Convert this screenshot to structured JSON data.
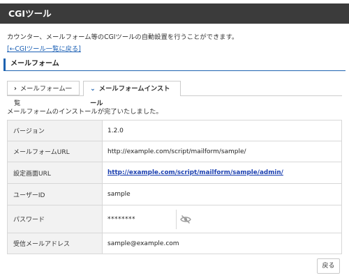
{
  "header": {
    "title": "CGIツール"
  },
  "intro": {
    "description": "カウンター、メールフォーム等のCGIツールの自動設置を行うことができます。",
    "back_link": "[←CGIツール一覧に戻る]"
  },
  "section": {
    "title": "メールフォーム"
  },
  "tabs": [
    {
      "label": "メールフォーム一覧",
      "icon": "chevron-right-icon",
      "active": false
    },
    {
      "label": "メールフォームインストール",
      "icon": "chevron-down-icon",
      "active": true
    }
  ],
  "message": "メールフォームのインストールが完了いたしました。",
  "details": {
    "version": {
      "label": "バージョン",
      "value": "1.2.0"
    },
    "url": {
      "label": "メールフォームURL",
      "value": "http://example.com/script/mailform/sample/"
    },
    "admin_url": {
      "label": "設定画面URL",
      "value": "http://example.com/script/mailform/sample/admin/"
    },
    "user_id": {
      "label": "ユーザーID",
      "value": "sample"
    },
    "password": {
      "label": "パスワード",
      "value": "********",
      "toggle_icon": "eye-slash-icon"
    },
    "email": {
      "label": "受信メールアドレス",
      "value": "sample@example.com"
    }
  },
  "actions": {
    "back_label": "戻る"
  },
  "colors": {
    "header_bg": "#3b3b3b",
    "accent": "#1e63b0",
    "link": "#1a3fb0"
  }
}
